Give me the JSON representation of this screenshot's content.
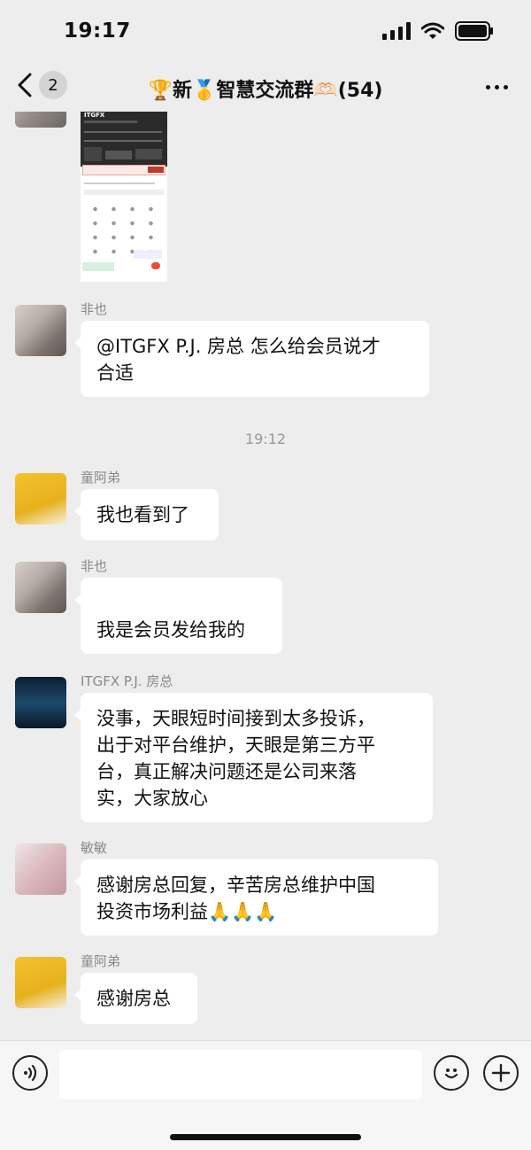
{
  "status": {
    "time": "19:17"
  },
  "nav": {
    "back_count": "2",
    "title": "🏆新🥇智慧交流群🫶🏻(54)"
  },
  "shared_image": {
    "brand": "ITGFX"
  },
  "time_separator": "19:12",
  "messages": [
    {
      "sender": "非也",
      "lines": [
        "@ITGFX P.J. 房总 怎么给会员说才",
        "合适"
      ]
    },
    {
      "sender": "童阿弟",
      "lines": [
        "我也看到了"
      ]
    },
    {
      "sender": "非也",
      "lines": [
        "",
        "我是会员发给我的"
      ]
    },
    {
      "sender": "ITGFX P.J. 房总",
      "lines": [
        "没事，天眼短时间接到太多投诉，",
        "出于对平台维护，天眼是第三方平",
        "台，真正解决问题还是公司来落",
        "实，大家放心"
      ]
    },
    {
      "sender": "敏敏",
      "lines": [
        " 感谢房总回复，辛苦房总维护中国",
        "投资市场利益🙏🙏🙏"
      ]
    },
    {
      "sender": "童阿弟",
      "lines": [
        "感谢房总"
      ]
    }
  ],
  "colors": {
    "background": "#ededed",
    "bubble": "#ffffff",
    "meta_text": "#888888"
  }
}
